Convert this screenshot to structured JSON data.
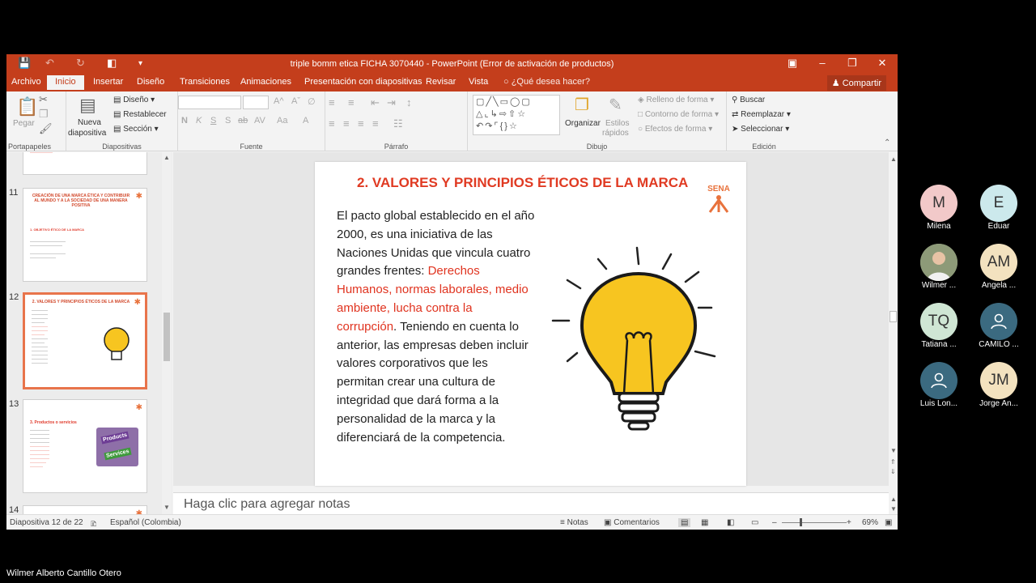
{
  "window": {
    "title": "triple bomm etica FICHA  3070440 - PowerPoint (Error de activación de productos)",
    "accent": "#c43e1c"
  },
  "tabs": [
    {
      "label": "Archivo"
    },
    {
      "label": "Inicio"
    },
    {
      "label": "Insertar"
    },
    {
      "label": "Diseño"
    },
    {
      "label": "Transiciones"
    },
    {
      "label": "Animaciones"
    },
    {
      "label": "Presentación con diapositivas"
    },
    {
      "label": "Revisar"
    },
    {
      "label": "Vista"
    }
  ],
  "tell_me": "¿Qué desea hacer?",
  "share": "Compartir",
  "ribbon": {
    "clipboard": {
      "paste": "Pegar",
      "label": "Portapapeles"
    },
    "slides": {
      "new_slide_1": "Nueva",
      "new_slide_2": "diapositiva",
      "layout": "Diseño",
      "reset": "Restablecer",
      "section": "Sección",
      "label": "Diapositivas"
    },
    "font": {
      "label": "Fuente"
    },
    "paragraph": {
      "label": "Párrafo"
    },
    "drawing": {
      "arrange": "Organizar",
      "styles_1": "Estilos",
      "styles_2": "rápidos",
      "fill": "Relleno de forma",
      "outline": "Contorno de forma",
      "effects": "Efectos de forma",
      "label": "Dibujo"
    },
    "editing": {
      "find": "Buscar",
      "replace": "Reemplazar",
      "select": "Seleccionar",
      "label": "Edición"
    }
  },
  "thumbnails": {
    "numbers": [
      "11",
      "12",
      "13",
      "14"
    ],
    "t11_title": "CREACIÓN DE UNA MARCA ÉTICA Y CONTRIBUIR AL MUNDO Y A LA SOCIEDAD DE UNA MANERA POSITIVA",
    "t11_sub": "1. OBJETIVO ÉTICO DE LA MARCA",
    "t12_title": "2. VALORES Y PRINCIPIOS ÉTICOS DE LA MARCA",
    "t13_title": "3. Productos o servicios",
    "t13_img_1": "Products",
    "t13_img_2": "Services"
  },
  "slide": {
    "title": "2. VALORES Y PRINCIPIOS ÉTICOS DE LA MARCA",
    "logo": "SENA",
    "body_1": "El pacto global establecido en el año 2000, es una iniciativa de las Naciones Unidas que vincula cuatro grandes frentes:",
    "body_red": "Derechos Humanos, normas laborales, medio ambiente, lucha contra la corrupción",
    "body_dot": ".",
    "body_2": "Teniendo en cuenta lo anterior, las empresas deben incluir valores corporativos que les permitan crear una cultura de integridad que dará forma a la personalidad de la marca y la diferenciará de la competencia."
  },
  "notes_placeholder": "Haga clic para agregar notas",
  "status": {
    "slide": "Diapositiva 12 de 22",
    "language": "Español (Colombia)",
    "notes": "Notas",
    "comments": "Comentarios",
    "zoom": "69%"
  },
  "participants": [
    {
      "initials": "M",
      "name": "Milena",
      "color": "#f2c9c9"
    },
    {
      "initials": "E",
      "name": "Eduar",
      "color": "#cce9ec"
    },
    {
      "initials": "",
      "name": "Wilmer ...",
      "color": "#7a8a70"
    },
    {
      "initials": "AM",
      "name": "Angela ...",
      "color": "#f3e2bf"
    },
    {
      "initials": "TQ",
      "name": "Tatiana ...",
      "color": "#cfe6d4"
    },
    {
      "initials": "",
      "name": "CAMILO ...",
      "color": "#3b6a80"
    },
    {
      "initials": "",
      "name": "Luis Lon...",
      "color": "#3b6a80"
    },
    {
      "initials": "JM",
      "name": "Jorge An...",
      "color": "#f3e2bf"
    }
  ],
  "presenter": "Wilmer Alberto Cantillo Otero"
}
